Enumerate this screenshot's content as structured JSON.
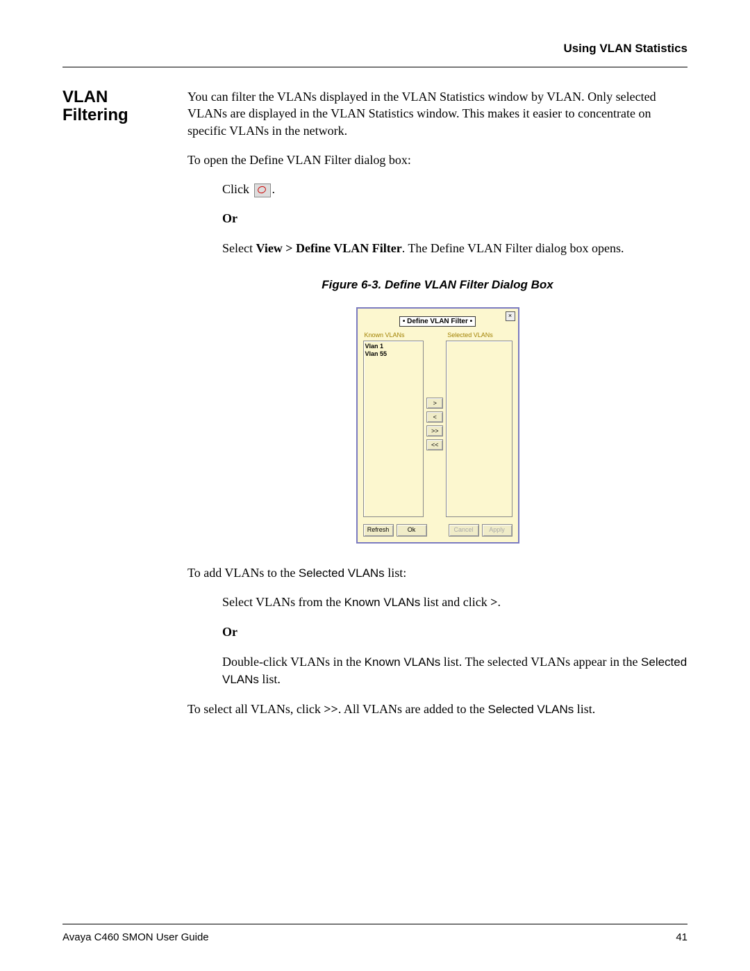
{
  "header": {
    "title": "Using VLAN Statistics"
  },
  "side": {
    "heading_line1": "VLAN",
    "heading_line2": "Filtering"
  },
  "body": {
    "p1": "You can filter the VLANs displayed in the VLAN Statistics window by VLAN. Only selected VLANs are displayed in the VLAN Statistics window. This makes it easier to concentrate on specific VLANs in the network.",
    "p2": "To open the Define VLAN Filter dialog box:",
    "click_prefix": "Click ",
    "click_suffix": ".",
    "or1": "Or",
    "select_prefix": "Select ",
    "select_menu": "View > Define VLAN Filter",
    "select_suffix": ". The Define VLAN Filter dialog box opens.",
    "figure_caption": "Figure 6-3.  Define VLAN Filter Dialog Box",
    "p_add_prefix": "To add VLANs to the ",
    "p_add_list": "Selected VLANs",
    "p_add_suffix": " list:",
    "select_vlans_prefix": "Select VLANs from the ",
    "select_vlans_list": "Known VLANs",
    "select_vlans_mid": " list and click ",
    "select_vlans_btn": ">",
    "select_vlans_suffix": ".",
    "or2": "Or",
    "dbl_prefix": "Double-click VLANs in the ",
    "dbl_list1": "Known VLANs",
    "dbl_mid": " list. The selected VLANs appear in the ",
    "dbl_list2": "Selected VLANs",
    "dbl_suffix": " list.",
    "selectall_prefix": "To select all VLANs, click ",
    "selectall_btn": ">>",
    "selectall_mid": ". All VLANs are added to the ",
    "selectall_list": "Selected VLANs",
    "selectall_suffix": " list."
  },
  "dialog": {
    "close": "×",
    "title": "• Define VLAN Filter •",
    "known_label": "Known VLANs",
    "selected_label": "Selected VLANs",
    "known_items": "Vlan 1\nVlan 55",
    "btn_right": ">",
    "btn_left": "<",
    "btn_right_all": ">>",
    "btn_left_all": "<<",
    "btn_refresh": "Refresh",
    "btn_ok": "Ok",
    "btn_cancel": "Cancel",
    "btn_apply": "Apply"
  },
  "footer": {
    "guide": "Avaya C460 SMON User Guide",
    "page": "41"
  }
}
